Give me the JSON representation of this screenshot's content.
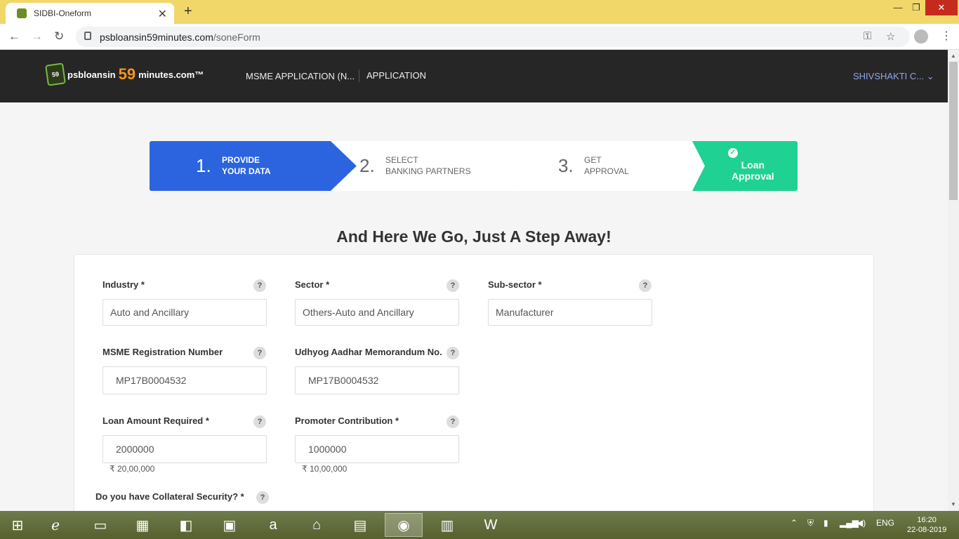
{
  "browser": {
    "tab_title": "SIDBI-Oneform",
    "tab_close": "✕",
    "new_tab": "+",
    "url_host": "psbloansin59minutes.com",
    "url_path": "/soneForm",
    "win_min": "—",
    "win_max": "❐",
    "win_close": "✕"
  },
  "header": {
    "logo_badge": "59",
    "logo_part1": "psbloansin",
    "logo_part2": "59",
    "logo_part3": "minutes.com™",
    "nav_msme": "MSME APPLICATION (N...",
    "nav_application": "APPLICATION",
    "user": "SHIVSHAKTI C..."
  },
  "steps": [
    {
      "num": "1.",
      "line1": "PROVIDE",
      "line2": "YOUR DATA"
    },
    {
      "num": "2.",
      "line1": "SELECT",
      "line2": "BANKING PARTNERS"
    },
    {
      "num": "3.",
      "line1": "GET",
      "line2": "APPROVAL"
    },
    {
      "line1": "Loan",
      "line2": "Approval"
    }
  ],
  "heading": "And Here We Go, Just A Step Away!",
  "form": {
    "industry_label": "Industry *",
    "industry_value": "Auto and Ancillary",
    "sector_label": "Sector *",
    "sector_value": "Others-Auto and Ancillary",
    "subsector_label": "Sub-sector *",
    "subsector_value": "Manufacturer",
    "msme_label": "MSME Registration Number",
    "msme_value": "MP17B0004532",
    "udhyog_label": "Udhyog Aadhar Memorandum No.",
    "udhyog_value": "MP17B0004532",
    "loan_label": "Loan Amount Required *",
    "loan_value": "2000000",
    "loan_note": "₹ 20,00,000",
    "promoter_label": "Promoter Contribution *",
    "promoter_value": "1000000",
    "promoter_note": "₹ 10,00,000",
    "collateral_label": "Do you have Collateral Security? *",
    "help": "?"
  },
  "taskbar": {
    "lang": "ENG",
    "time": "16:20",
    "date": "22-08-2019"
  }
}
